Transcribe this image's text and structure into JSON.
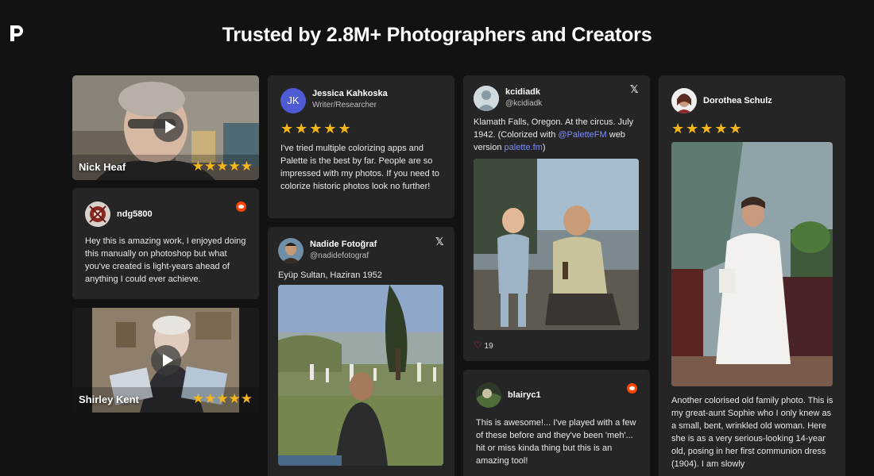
{
  "header": {
    "logo_icon": "palette-p-logo-icon",
    "title": "Trusted by 2.8M+ Photographers and Creators"
  },
  "colors": {
    "background": "#121212",
    "card": "#252525",
    "star": "#f5b61b",
    "link": "#7c8cff",
    "reddit": "#ff4500"
  },
  "stars_text": "★★★★★",
  "videos": [
    {
      "name": "Nick Heaf",
      "icon": "play-icon"
    },
    {
      "name": "Shirley Kent",
      "icon": "play-icon"
    }
  ],
  "reviews": {
    "ndg": {
      "username": "ndg5800",
      "platform_icon": "reddit-icon",
      "text": "Hey this is amazing work, I enjoyed doing this manually on photoshop but what you've created is light-years ahead of anything I could ever achieve."
    },
    "jessica": {
      "initials": "JK",
      "name": "Jessica Kahkoska",
      "role": "Writer/Researcher",
      "text": "I've tried multiple colorizing apps and Palette is the best by far. People are so impressed with my photos. If you need to colorize historic photos look no further!"
    },
    "nadide": {
      "name": "Nadide Fotoğraf",
      "handle": "@nadidefotograf",
      "platform_icon": "x-icon",
      "text": "Eyüp Sultan, Haziran 1952"
    },
    "kcidiadk": {
      "name": "kcidiadk",
      "handle": "@kcidiadk",
      "platform_icon": "x-icon",
      "text_before": "Klamath Falls, Oregon. At the circus. July 1942. (Colorized with ",
      "mention": "@PaletteFM",
      "text_mid": " web version ",
      "site": "palette.fm",
      "text_after": ")",
      "likes": "19"
    },
    "blairyc": {
      "username": "blairyc1",
      "platform_icon": "reddit-icon",
      "text": "This is awesome!... I've played with a few of these before and they've been 'meh'... hit or miss kinda thing but this is an amazing tool!"
    },
    "dorothea": {
      "name": "Dorothea Schulz",
      "text": "Another colorised old family photo. This is my great-aunt Sophie who I only knew as a small, bent, wrinkled old woman. Here she is as a very serious-looking 14-year old, posing in her first communion dress (1904). I am slowly"
    }
  }
}
